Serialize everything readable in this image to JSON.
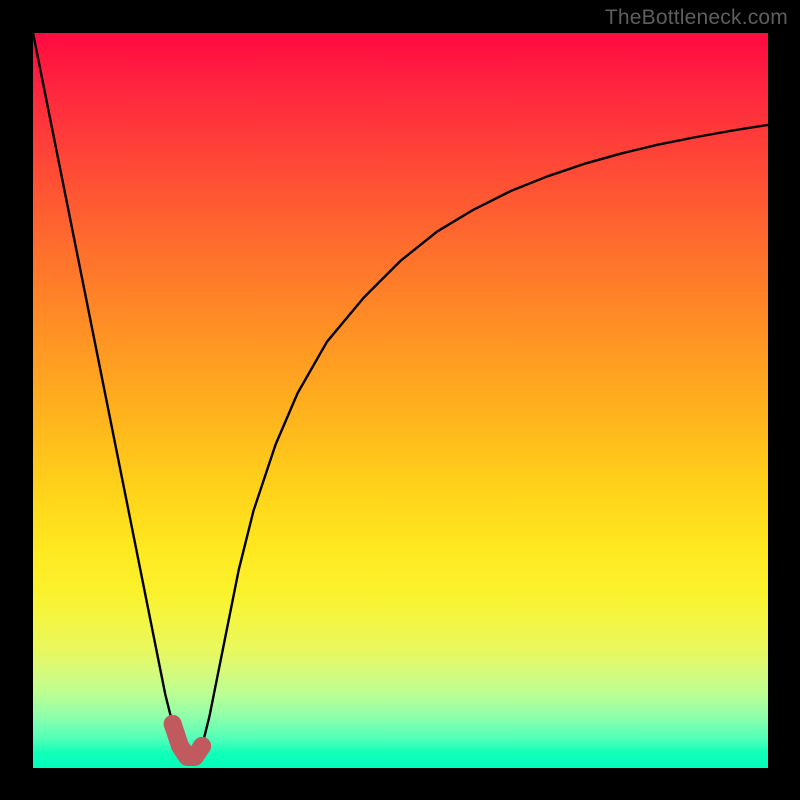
{
  "watermark": "TheBottleneck.com",
  "colors": {
    "background": "#000000",
    "curve": "#000000",
    "highlight": "#c05a5f",
    "gradient_top": "#ff0a40",
    "gradient_bottom": "#02ffba"
  },
  "chart_data": {
    "type": "line",
    "title": "",
    "xlabel": "",
    "ylabel": "",
    "xlim": [
      0,
      100
    ],
    "ylim": [
      0,
      100
    ],
    "grid": false,
    "series": [
      {
        "name": "bottleneck-curve",
        "x": [
          0,
          2,
          4,
          6,
          8,
          10,
          12,
          14,
          16,
          18,
          19,
          20,
          21,
          22,
          23,
          24,
          26,
          28,
          30,
          33,
          36,
          40,
          45,
          50,
          55,
          60,
          65,
          70,
          75,
          80,
          85,
          90,
          95,
          100
        ],
        "y": [
          100,
          90,
          80,
          70,
          60,
          50,
          40,
          30,
          20,
          10,
          6,
          3,
          1.5,
          1.5,
          3,
          7,
          17,
          27,
          35,
          44,
          51,
          58,
          64,
          69,
          73,
          76,
          78.5,
          80.5,
          82.2,
          83.6,
          84.8,
          85.8,
          86.7,
          87.5
        ]
      },
      {
        "name": "highlight-region",
        "x": [
          19,
          20,
          21,
          22,
          23
        ],
        "y": [
          6,
          3,
          1.5,
          1.5,
          3
        ]
      }
    ]
  }
}
